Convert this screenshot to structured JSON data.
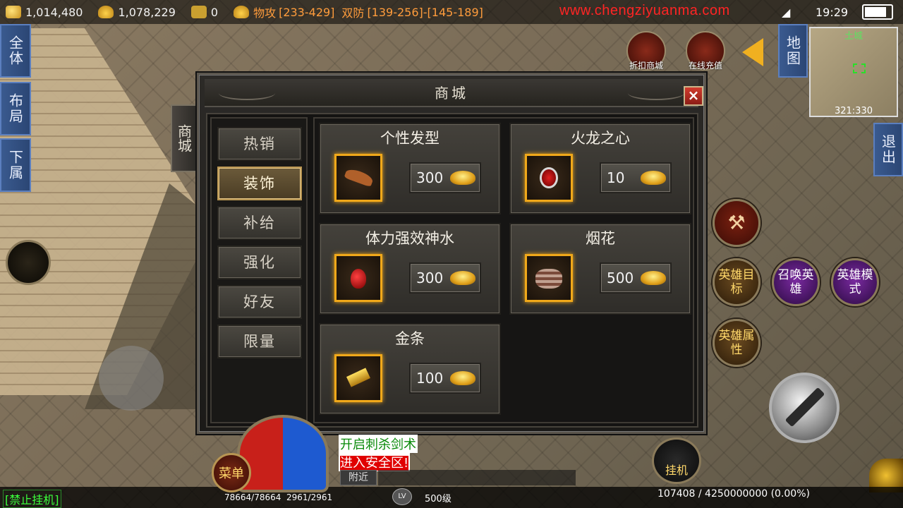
{
  "topbar": {
    "gold": "1,014,480",
    "ingots": "1,078,229",
    "items_count": "0",
    "phys_attack_label": "物攻",
    "phys_attack": "[233-429]",
    "dual_def_label": "双防",
    "dual_def": "[139-256]-[145-189]",
    "watermark": "www.chengziyuanma.com",
    "time": "19:29"
  },
  "left_tabs": [
    "全体",
    "布局",
    "下属"
  ],
  "shop": {
    "side_tab": "商城",
    "title": "商城",
    "close": "×",
    "categories": [
      "热销",
      "装饰",
      "补给",
      "强化",
      "好友",
      "限量"
    ],
    "active_category": "装饰",
    "items": [
      {
        "name": "个性发型",
        "price": "300",
        "icon": "comb-icon"
      },
      {
        "name": "火龙之心",
        "price": "10",
        "icon": "dragon-heart-icon"
      },
      {
        "name": "体力强效神水",
        "price": "300",
        "icon": "potion-icon"
      },
      {
        "name": "烟花",
        "price": "500",
        "icon": "firework-icon"
      },
      {
        "name": "金条",
        "price": "100",
        "icon": "gold-bar-icon"
      }
    ]
  },
  "top_right": {
    "discount_shop": "折扣商城",
    "online_recharge": "在线充值",
    "map_tab": "地图",
    "exit_tab": "退出",
    "minimap_area": "土城",
    "minimap_coords": "321:330"
  },
  "hero_buttons": {
    "hero_target": "英雄目标",
    "summon_hero": "召唤英雄",
    "hero_mode": "英雄模式",
    "hero_attr": "英雄属性"
  },
  "bottom": {
    "afk_ban": "[禁止挂机]",
    "menu": "菜单",
    "hp": "78664/78664",
    "mp": "2961/2961",
    "chat_line1": "开启刺杀剑术",
    "chat_line2": "进入安全区!",
    "nearby_tab": "附近",
    "level_badge": "LV",
    "level": "500级",
    "hang": "挂机",
    "exp": "107408 / 4250000000 (0.00%)"
  },
  "colors": {
    "accent_gold": "#f0a81a",
    "watermark_red": "#ff2424",
    "afk_green": "#3cff3c"
  }
}
